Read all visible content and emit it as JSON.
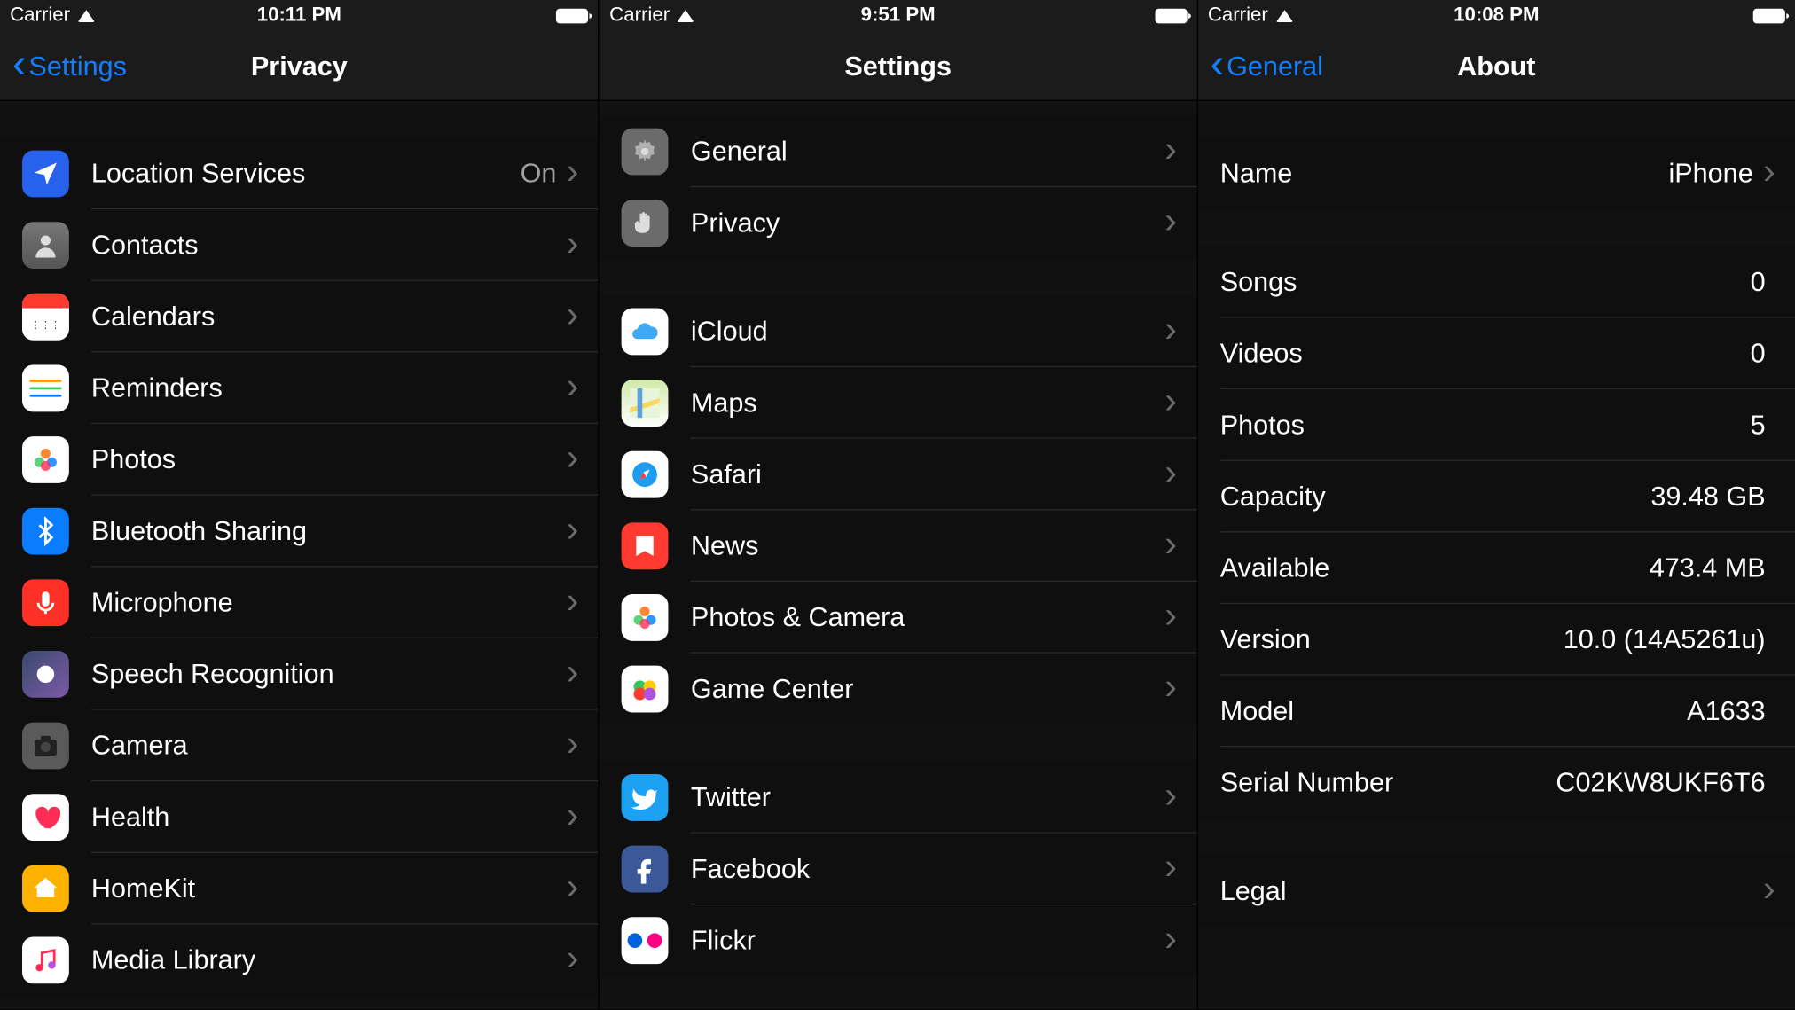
{
  "pane1": {
    "status": {
      "carrier": "Carrier",
      "time": "10:11 PM"
    },
    "nav": {
      "back": "Settings",
      "title": "Privacy"
    },
    "groups": [
      [
        {
          "icon": "loc",
          "label": "Location Services",
          "value": "On",
          "id": "location-services"
        },
        {
          "icon": "contacts",
          "label": "Contacts",
          "id": "contacts"
        },
        {
          "icon": "cal",
          "label": "Calendars",
          "id": "calendars"
        },
        {
          "icon": "rem",
          "label": "Reminders",
          "id": "reminders"
        },
        {
          "icon": "photos",
          "label": "Photos",
          "id": "photos"
        },
        {
          "icon": "bt",
          "label": "Bluetooth Sharing",
          "id": "bluetooth-sharing"
        },
        {
          "icon": "mic",
          "label": "Microphone",
          "id": "microphone"
        },
        {
          "icon": "speech",
          "label": "Speech Recognition",
          "id": "speech-recognition"
        },
        {
          "icon": "cam",
          "label": "Camera",
          "id": "camera"
        },
        {
          "icon": "health",
          "label": "Health",
          "id": "health"
        },
        {
          "icon": "homekit",
          "label": "HomeKit",
          "id": "homekit"
        },
        {
          "icon": "media",
          "label": "Media Library",
          "id": "media-library"
        }
      ]
    ]
  },
  "pane2": {
    "status": {
      "carrier": "Carrier",
      "time": "9:51 PM"
    },
    "nav": {
      "title": "Settings"
    },
    "groups": [
      [
        {
          "icon": "gear",
          "label": "General",
          "id": "general"
        },
        {
          "icon": "hand",
          "label": "Privacy",
          "id": "privacy"
        }
      ],
      [
        {
          "icon": "cloud",
          "label": "iCloud",
          "id": "icloud"
        },
        {
          "icon": "maps",
          "label": "Maps",
          "id": "maps"
        },
        {
          "icon": "safari",
          "label": "Safari",
          "id": "safari"
        },
        {
          "icon": "news",
          "label": "News",
          "id": "news"
        },
        {
          "icon": "photos",
          "label": "Photos & Camera",
          "id": "photos-camera"
        },
        {
          "icon": "gc",
          "label": "Game Center",
          "id": "game-center"
        }
      ],
      [
        {
          "icon": "tw",
          "label": "Twitter",
          "id": "twitter"
        },
        {
          "icon": "fb",
          "label": "Facebook",
          "id": "facebook"
        },
        {
          "icon": "flickr",
          "label": "Flickr",
          "id": "flickr"
        }
      ]
    ]
  },
  "pane3": {
    "status": {
      "carrier": "Carrier",
      "time": "10:08 PM"
    },
    "nav": {
      "back": "General",
      "title": "About"
    },
    "groups": [
      [
        {
          "label": "Name",
          "value": "iPhone",
          "chevron": true,
          "id": "name"
        }
      ],
      [
        {
          "label": "Songs",
          "value": "0",
          "id": "songs"
        },
        {
          "label": "Videos",
          "value": "0",
          "id": "videos"
        },
        {
          "label": "Photos",
          "value": "5",
          "id": "photos-count"
        },
        {
          "label": "Capacity",
          "value": "39.48 GB",
          "id": "capacity"
        },
        {
          "label": "Available",
          "value": "473.4 MB",
          "id": "available"
        },
        {
          "label": "Version",
          "value": "10.0 (14A5261u)",
          "id": "version"
        },
        {
          "label": "Model",
          "value": "A1633",
          "id": "model"
        },
        {
          "label": "Serial Number",
          "value": "C02KW8UKF6T6",
          "id": "serial-number"
        }
      ],
      [
        {
          "label": "Legal",
          "chevron": true,
          "id": "legal"
        }
      ]
    ]
  }
}
